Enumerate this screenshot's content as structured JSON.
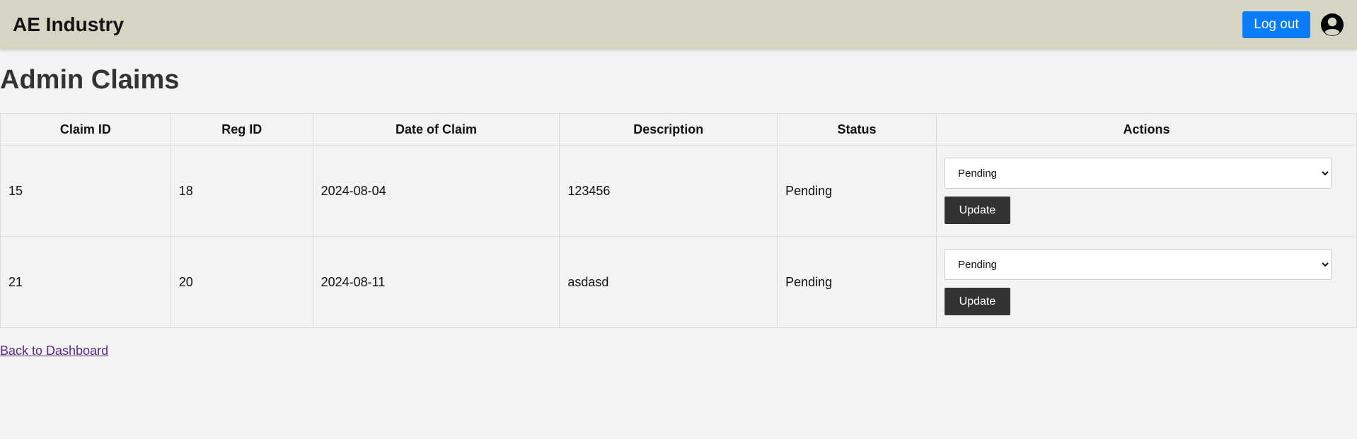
{
  "header": {
    "brand": "AE Industry",
    "logout_label": "Log out",
    "avatar_icon": "user-circle-icon",
    "background_color": "#d6d5c4",
    "logout_color": "#0a7cf7"
  },
  "page": {
    "title": "Admin Claims"
  },
  "table": {
    "columns": [
      "Claim ID",
      "Reg ID",
      "Date of Claim",
      "Description",
      "Status",
      "Actions"
    ],
    "rows": [
      {
        "claim_id": "15",
        "reg_id": "18",
        "date": "2024-08-04",
        "description": "123456",
        "status": "Pending",
        "select_value": "Pending",
        "update_label": "Update"
      },
      {
        "claim_id": "21",
        "reg_id": "20",
        "date": "2024-08-11",
        "description": "asdasd",
        "status": "Pending",
        "select_value": "Pending",
        "update_label": "Update"
      }
    ]
  },
  "footer": {
    "back_link": "Back to Dashboard"
  }
}
